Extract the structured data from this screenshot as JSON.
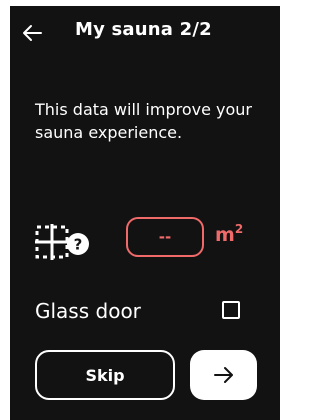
{
  "header": {
    "title": "My sauna 2/2",
    "back_icon": "arrow-left-icon"
  },
  "description": "This data will improve your sauna experience.",
  "area": {
    "icon": "room-area-question-icon",
    "value": "--",
    "unit": "m",
    "unit_exponent": "2"
  },
  "glass_door": {
    "label": "Glass door",
    "checked": false
  },
  "actions": {
    "skip_label": "Skip",
    "next_icon": "arrow-right-icon"
  },
  "colors": {
    "background": "#121212",
    "accent": "#f06a6a",
    "text": "#ffffff"
  }
}
